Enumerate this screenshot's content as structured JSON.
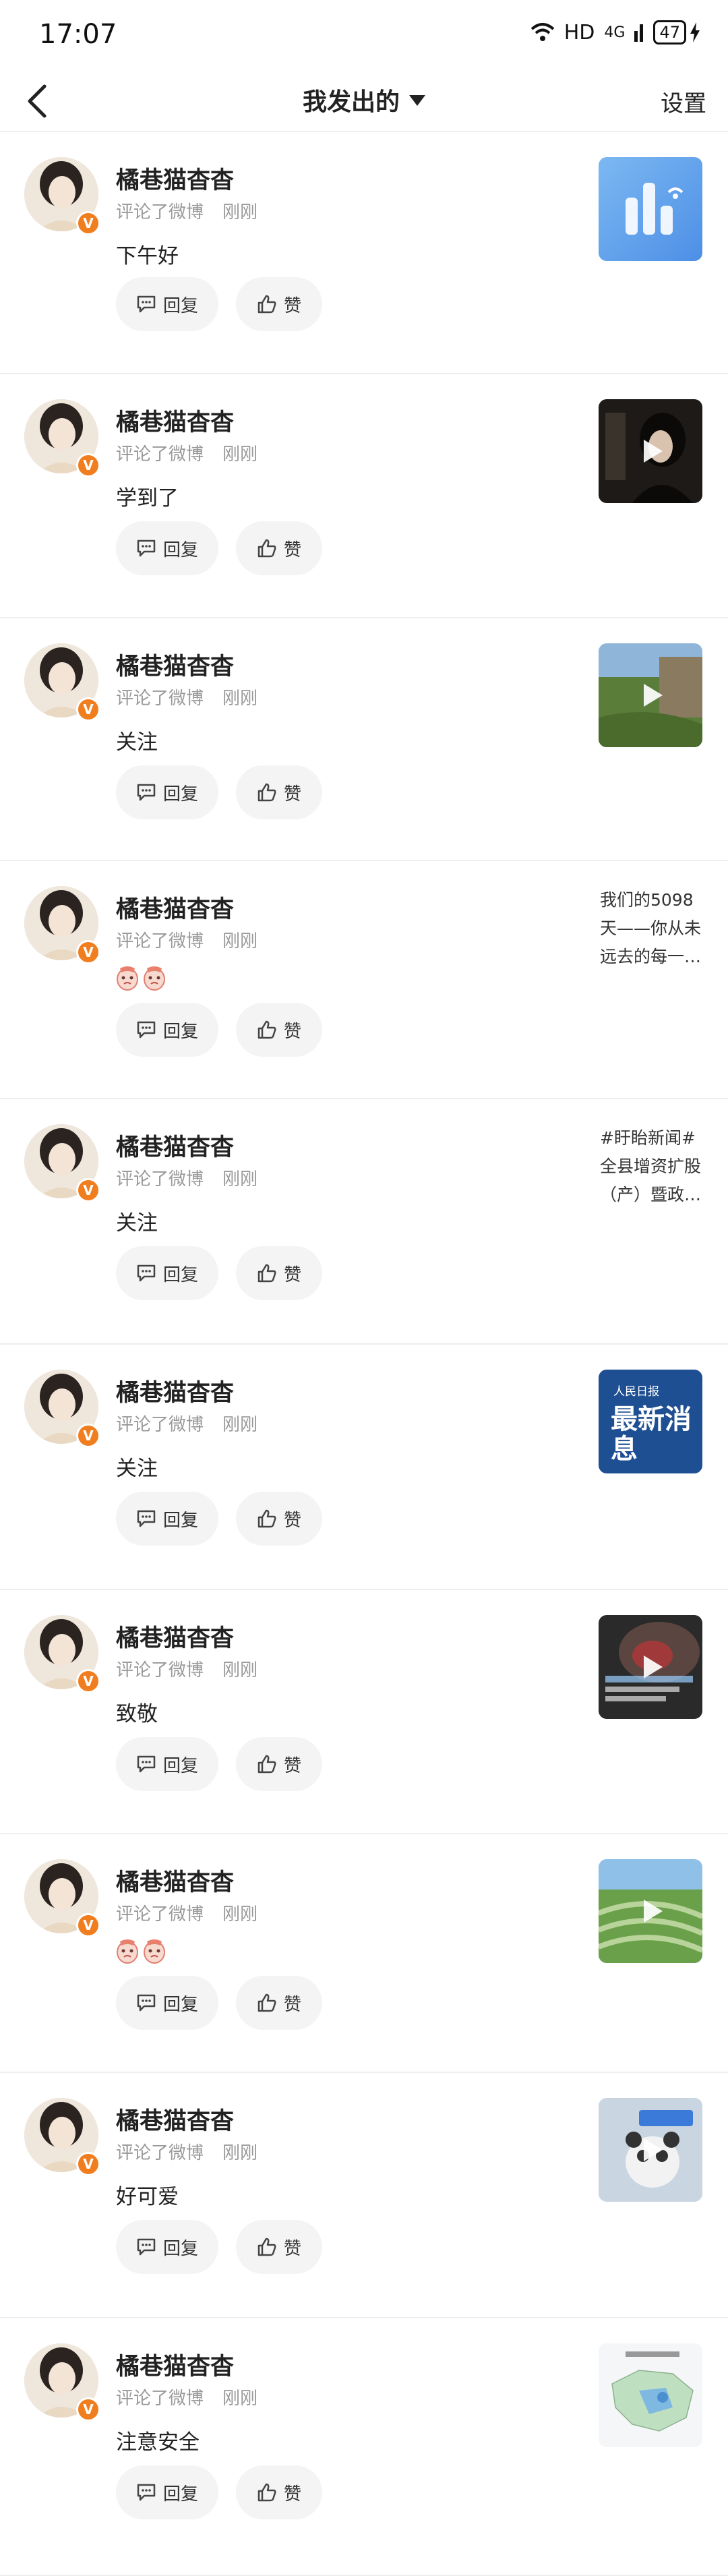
{
  "status_bar": {
    "time": "17:07",
    "network_label": "HD",
    "signal_label": "4G",
    "battery": "47"
  },
  "nav": {
    "title": "我发出的",
    "settings": "设置"
  },
  "comments": [
    {
      "user": "橘巷猫杳杳",
      "action": "评论了微博",
      "time": "刚刚",
      "text": "下午好",
      "thumb": "app-icon",
      "reply": "回复",
      "like": "赞"
    },
    {
      "user": "橘巷猫杳杳",
      "action": "评论了微博",
      "time": "刚刚",
      "text": "学到了",
      "thumb": "video-woman",
      "reply": "回复",
      "like": "赞"
    },
    {
      "user": "橘巷猫杳杳",
      "action": "评论了微博",
      "time": "刚刚",
      "text": "关注",
      "thumb": "video-grass",
      "reply": "回复",
      "like": "赞"
    },
    {
      "user": "橘巷猫杳杳",
      "action": "评论了微博",
      "time": "刚刚",
      "text": "",
      "emoji": true,
      "thumb_text": "我们的5098天——你从未远去的每一…",
      "reply": "回复",
      "like": "赞"
    },
    {
      "user": "橘巷猫杳杳",
      "action": "评论了微博",
      "time": "刚刚",
      "text": "关注",
      "thumb_text": "#盱眙新闻#全县增资扩股（产）暨政…",
      "reply": "回复",
      "like": "赞"
    },
    {
      "user": "橘巷猫杳杳",
      "action": "评论了微博",
      "time": "刚刚",
      "text": "关注",
      "thumb": "news",
      "thumb_brand": "人民日报",
      "thumb_headline": "最新消息",
      "reply": "回复",
      "like": "赞"
    },
    {
      "user": "橘巷猫杳杳",
      "action": "评论了微博",
      "time": "刚刚",
      "text": "致敬",
      "thumb": "video-dark",
      "reply": "回复",
      "like": "赞"
    },
    {
      "user": "橘巷猫杳杳",
      "action": "评论了微博",
      "time": "刚刚",
      "text": "",
      "emoji": true,
      "thumb": "video-field",
      "reply": "回复",
      "like": "赞"
    },
    {
      "user": "橘巷猫杳杳",
      "action": "评论了微博",
      "time": "刚刚",
      "text": "好可爱",
      "thumb": "video-panda",
      "reply": "回复",
      "like": "赞"
    },
    {
      "user": "橘巷猫杳杳",
      "action": "评论了微博",
      "time": "刚刚",
      "text": "注意安全",
      "thumb": "map",
      "reply": "回复",
      "like": "赞"
    }
  ]
}
